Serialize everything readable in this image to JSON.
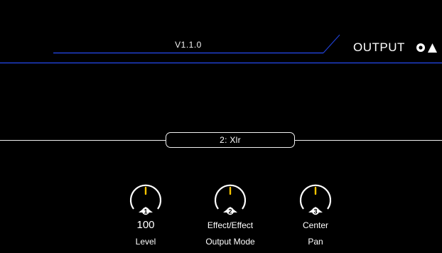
{
  "header": {
    "version": "V1.1.0",
    "title": "OUTPUT",
    "icons": [
      "circle-outline-icon",
      "triangle-up-icon"
    ],
    "accent_color": "#1f3fd1"
  },
  "source": {
    "label": "2: Xlr"
  },
  "knobs": [
    {
      "index": "1",
      "value": "100",
      "label": "Level",
      "indicator_color": "#f5c400"
    },
    {
      "index": "2",
      "value": "Effect/Effect",
      "label": "Output Mode",
      "indicator_color": "#f5c400"
    },
    {
      "index": "3",
      "value": "Center",
      "label": "Pan",
      "indicator_color": "#f5c400"
    }
  ]
}
